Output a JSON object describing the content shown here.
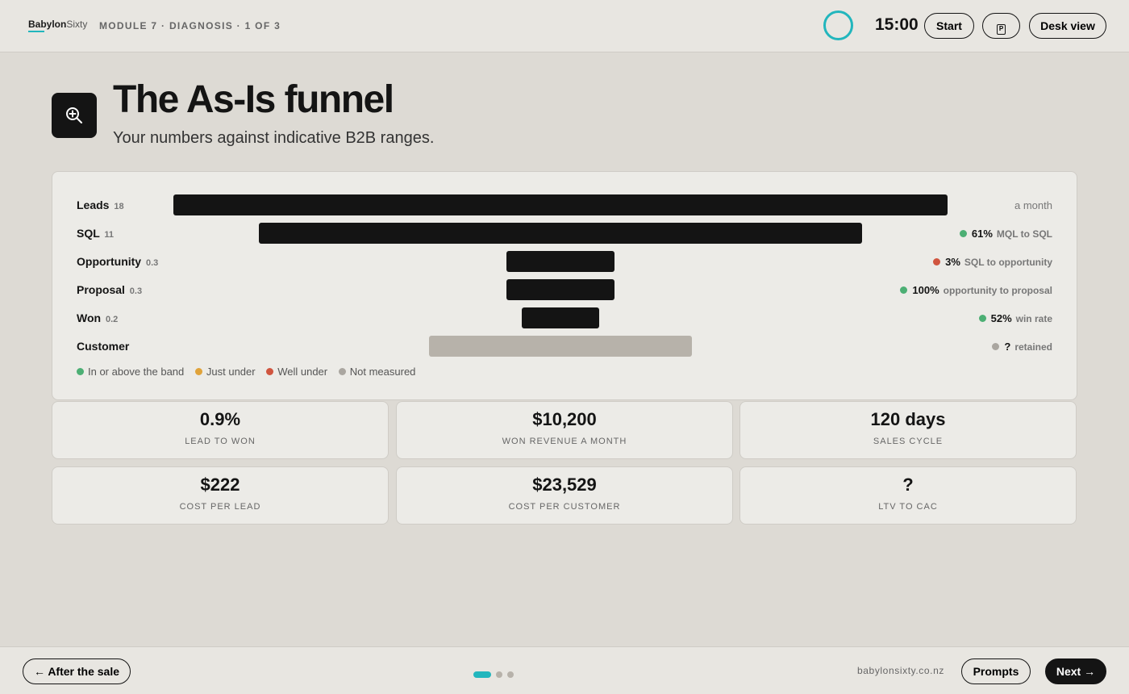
{
  "header": {
    "logo_bold": "Babylon",
    "logo_light": "Sixty",
    "module": "MODULE 7 · DIAGNOSIS · 1 OF 3",
    "timer": "15:00",
    "start_label": "Start",
    "notes_icon": "P",
    "desk_view_label": "Desk view",
    "ring_color": "#22b6bd"
  },
  "title": {
    "icon": "zoom-in-icon",
    "heading": "The As-Is funnel",
    "subtitle": "Your numbers against indicative B2B ranges."
  },
  "funnel": {
    "rows": [
      {
        "label": "Leads",
        "count": "18",
        "bar": "dark",
        "rate_value": "",
        "rate_label": "a month",
        "status": "none"
      },
      {
        "label": "SQL",
        "count": "11",
        "bar": "dark",
        "rate_value": "61%",
        "rate_label": "MQL to SQL",
        "status": "green"
      },
      {
        "label": "Opportunity",
        "count": "0.3",
        "bar": "dark",
        "rate_value": "3%",
        "rate_label": "SQL to opportunity",
        "status": "red"
      },
      {
        "label": "Proposal",
        "count": "0.3",
        "bar": "dark",
        "rate_value": "100%",
        "rate_label": "opportunity to proposal",
        "status": "green"
      },
      {
        "label": "Won",
        "count": "0.2",
        "bar": "dark",
        "rate_value": "52%",
        "rate_label": "win rate",
        "status": "green"
      },
      {
        "label": "Customer",
        "count": "",
        "bar": "grey",
        "rate_value": "?",
        "rate_label": "retained",
        "status": "grey"
      }
    ],
    "legend": [
      {
        "label": "In or above the band",
        "color": "#4caf74"
      },
      {
        "label": "Just under",
        "color": "#e0a33a"
      },
      {
        "label": "Well under",
        "color": "#d0553f"
      },
      {
        "label": "Not measured",
        "color": "#aaa6a0"
      }
    ],
    "status_colors": {
      "green": "#4caf74",
      "red": "#d0553f",
      "amber": "#e0a33a",
      "grey": "#aaa6a0"
    }
  },
  "metrics": [
    {
      "value": "0.9%",
      "caption": "LEAD TO WON"
    },
    {
      "value": "$10,200",
      "caption": "WON REVENUE A MONTH"
    },
    {
      "value": "120 days",
      "caption": "SALES CYCLE"
    },
    {
      "value": "$222",
      "caption": "COST PER LEAD"
    },
    {
      "value": "$23,529",
      "caption": "COST PER CUSTOMER"
    },
    {
      "value": "?",
      "caption": "LTV TO CAC"
    }
  ],
  "footer": {
    "back_label": "← After the sale",
    "site": "babylonsixty.co.nz",
    "prompts_label": "Prompts",
    "next_label": "Next →",
    "page_count": 3,
    "active_page": 1
  }
}
